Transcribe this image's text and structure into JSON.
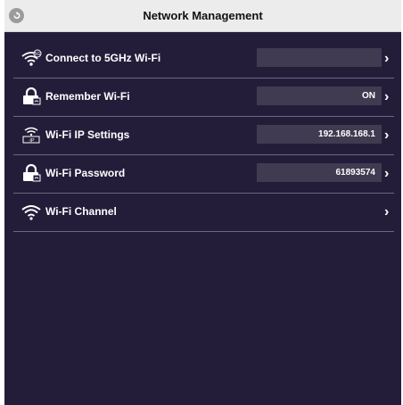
{
  "header": {
    "title": "Network Management"
  },
  "rows": [
    {
      "label": "Connect to 5GHz Wi-Fi",
      "value": "",
      "icon": "wifi-5ghz-icon"
    },
    {
      "label": "Remember Wi-Fi",
      "value": "ON",
      "icon": "lock-icon"
    },
    {
      "label": "Wi-Fi IP Settings",
      "value": "192.168.168.1",
      "icon": "wifi-ip-icon"
    },
    {
      "label": "Wi-Fi Password",
      "value": "61893574",
      "icon": "lock-icon"
    },
    {
      "label": "Wi-Fi Channel",
      "value": "",
      "icon": "wifi-icon"
    }
  ],
  "chevron": "›",
  "colors": {
    "background": "#241d3a",
    "header": "#ececec",
    "value_box": "#403b51",
    "divider": "#6a6680"
  }
}
